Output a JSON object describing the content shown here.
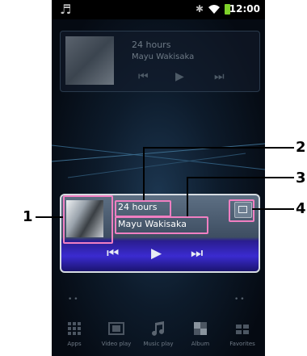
{
  "status_bar": {
    "time": "12:00",
    "music_icon": "music-note-icon",
    "bluetooth_icon": "bluetooth-icon",
    "wifi_icon": "wifi-icon",
    "battery_icon": "battery-icon"
  },
  "background_widget": {
    "title": "24 hours",
    "artist": "Mayu Wakisaka",
    "prev": "⏮",
    "play": "▶",
    "next": "⏭"
  },
  "music_widget": {
    "title": "24 hours",
    "artist": "Mayu Wakisaka",
    "prev": "⏮",
    "play": "▶",
    "next": "⏭"
  },
  "dock": {
    "items": [
      {
        "label": "Apps",
        "icon": "apps-grid-icon"
      },
      {
        "label": "Video play",
        "icon": "film-icon"
      },
      {
        "label": "Music play",
        "icon": "music-note-icon"
      },
      {
        "label": "Album",
        "icon": "album-icon"
      },
      {
        "label": "Favorites",
        "icon": "favorites-icon"
      }
    ]
  },
  "callouts": {
    "c1": "1",
    "c2": "2",
    "c3": "3",
    "c4": "4"
  },
  "colors": {
    "highlight": "#f07fc2",
    "widget_accent": "#3a2bd0"
  }
}
